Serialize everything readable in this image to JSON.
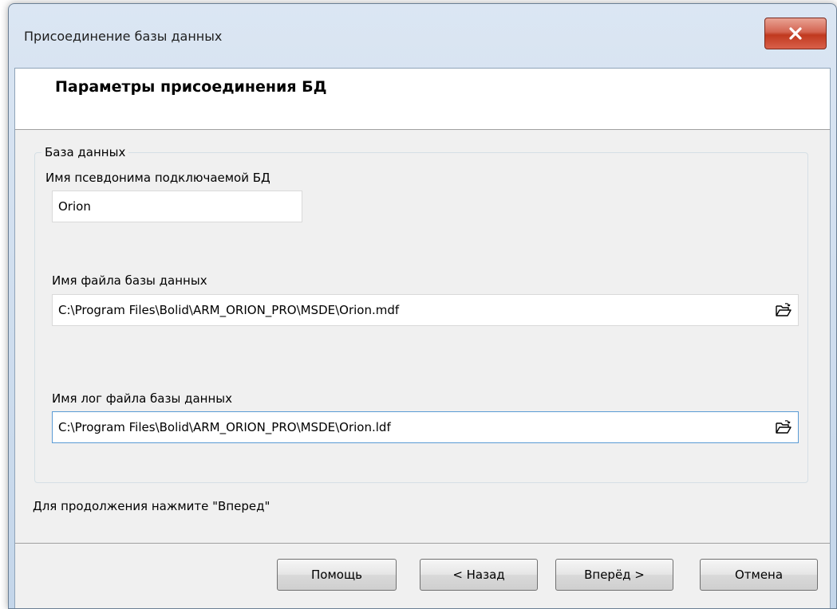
{
  "window": {
    "title": "Присоединение базы данных",
    "close_glyph": "X"
  },
  "header": {
    "title": "Параметры присоединения БД"
  },
  "group": {
    "legend": "База данных",
    "alias": {
      "label": "Имя псевдонима подключаемой БД",
      "value": "Orion"
    },
    "db_file": {
      "label": "Имя файла базы данных",
      "value": "C:\\Program Files\\Bolid\\ARM_ORION_PRO\\MSDE\\Orion.mdf",
      "icon": "folder-open-icon"
    },
    "log_file": {
      "label": "Имя лог файла базы данных",
      "value": "C:\\Program Files\\Bolid\\ARM_ORION_PRO\\MSDE\\Orion.ldf",
      "icon": "folder-open-icon"
    }
  },
  "hint": "Для продолжения нажмите \"Вперед\"",
  "buttons": {
    "help": "Помощь",
    "back": "< Назад",
    "next": "Вперёд >",
    "cancel": "Отмена"
  },
  "colors": {
    "close_button": "#c0391f",
    "focus_border": "#5a9bd5"
  }
}
